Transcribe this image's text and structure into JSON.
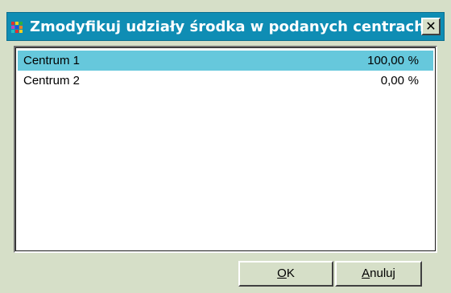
{
  "window": {
    "title": "Zmodyfikuj udziały środka w podanych centrach",
    "close_label": "✕"
  },
  "list": {
    "rows": [
      {
        "name": "Centrum 1",
        "value": "100,00",
        "unit": "%",
        "selected": true
      },
      {
        "name": "Centrum 2",
        "value": "0,00",
        "unit": "%",
        "selected": false
      }
    ]
  },
  "buttons": {
    "ok": {
      "mnemonic": "O",
      "rest": "K"
    },
    "cancel": {
      "mnemonic": "A",
      "rest": "nuluj"
    }
  },
  "colors": {
    "titlebar": "#0f8db4",
    "selection": "#66c8dc",
    "face": "#d6dfc8"
  }
}
